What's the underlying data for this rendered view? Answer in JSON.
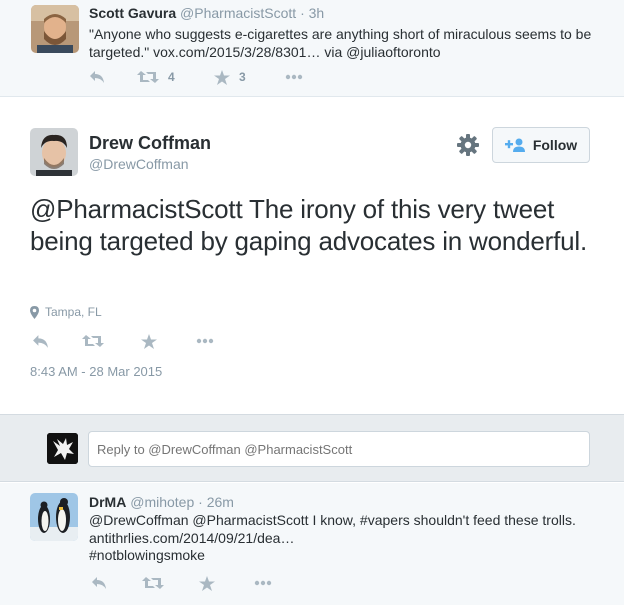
{
  "parent_tweet": {
    "name": "Scott Gavura",
    "handle": "@PharmacistScott",
    "separator": "·",
    "time": "3h",
    "text_quote": "\"Anyone who suggests e-cigarettes are anything short of miraculous seems to be targeted.\"",
    "text_link": "vox.com/2015/3/28/8301…",
    "text_via": "via",
    "text_mention": "@juliaoftoronto",
    "retweet_count": "4",
    "favorite_count": "3"
  },
  "main_tweet": {
    "name": "Drew Coffman",
    "handle": "@DrewCoffman",
    "follow_label": "Follow",
    "text": "@PharmacistScott The irony of this very tweet being targeted by gaping advocates in wonderful.",
    "location": "Tampa, FL",
    "timestamp": "8:43 AM - 28 Mar 2015"
  },
  "reply_box": {
    "placeholder": "Reply to @DrewCoffman @PharmacistScott"
  },
  "reply_tweet": {
    "name": "DrMA",
    "handle": "@mihotep",
    "separator": "·",
    "time": "26m",
    "line1": "@DrewCoffman @PharmacistScott I know, #vapers shouldn't feed these trolls.",
    "line2": "antithrlies.com/2014/09/21/dea…",
    "line3": "#notblowingsmoke"
  },
  "colors": {
    "icon_gray": "#aab8c2",
    "follow_blue": "#55acee",
    "text_dark": "#292f33",
    "text_muted": "#8899a6"
  },
  "icons": {
    "reply": "reply-arrow-icon",
    "retweet": "retweet-icon",
    "favorite": "star-icon",
    "more": "ellipsis-icon",
    "gear": "gear-icon",
    "follow": "add-person-icon",
    "location": "map-pin-icon"
  }
}
